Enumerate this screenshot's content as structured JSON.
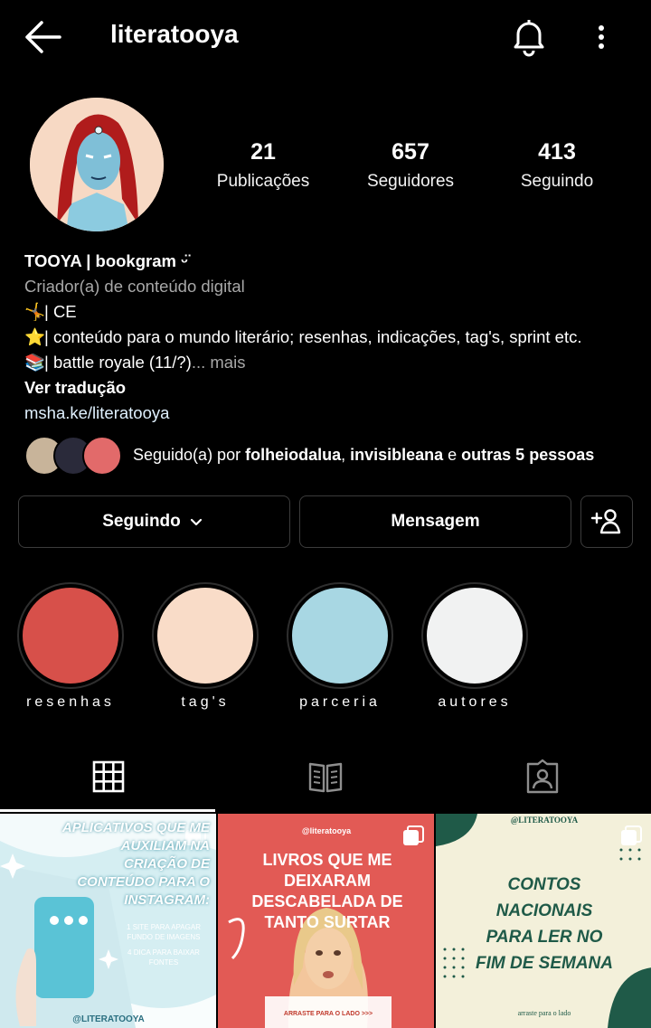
{
  "header": {
    "username": "literatooya"
  },
  "stats": {
    "posts": {
      "value": "21",
      "label": "Publicações"
    },
    "followers": {
      "value": "657",
      "label": "Seguidores"
    },
    "following": {
      "value": "413",
      "label": "Seguindo"
    }
  },
  "bio": {
    "name": "TOOYA | bookgram ᵕ̈",
    "category": "Criador(a) de conteúdo digital",
    "lines": [
      {
        "emoji": "🤸",
        "text": "| CE"
      },
      {
        "emoji": "⭐",
        "text": "| conteúdo para o mundo literário; resenhas, indicações, tag's, sprint etc."
      },
      {
        "emoji": "📚",
        "text": "| battle royale (11/?)"
      }
    ],
    "more": "... mais",
    "translate": "Ver tradução",
    "link": "msha.ke/literatooya"
  },
  "followed_by": {
    "prefix": "Seguido(a) por ",
    "user1": "folheiodalua",
    "sep": ", ",
    "user2": "invisibleana",
    "mid": " e ",
    "others": "outras 5 pessoas"
  },
  "actions": {
    "following": "Seguindo",
    "message": "Mensagem"
  },
  "highlights": [
    {
      "label": "resenhas",
      "color": "#d7504a"
    },
    {
      "label": "tag's",
      "color": "#f9dcc8"
    },
    {
      "label": "parceria",
      "color": "#a8d7e3"
    },
    {
      "label": "autores",
      "color": "#f1f2f2"
    }
  ],
  "posts": {
    "p1": {
      "title": "APLICATIVOS QUE ME AUXILIAM NA CRIAÇÃO DE CONTEÚDO PARA O INSTAGRAM:",
      "tip1": "1 SITE PARA APAGAR FUNDO DE IMAGENS",
      "tip2": "4 DICA PARA BAIXAR FONTES",
      "handle": "@LITERATOOYA"
    },
    "p2": {
      "handle": "@literatooya",
      "title": "LIVROS QUE ME DEIXARAM DESCABELADA DE TANTO SURTAR",
      "footer": "ARRASTE PARA O LADO >>>"
    },
    "p3": {
      "handle": "@LITERATOOYA",
      "title": "CONTOS NACIONAIS PARA LER NO FIM DE SEMANA",
      "footer": "arraste para o lado"
    }
  },
  "colors": {
    "background": "#000000",
    "button_border": "#3c3c3c",
    "secondary_text": "#a8a8a8",
    "link": "#e0f1ff"
  }
}
